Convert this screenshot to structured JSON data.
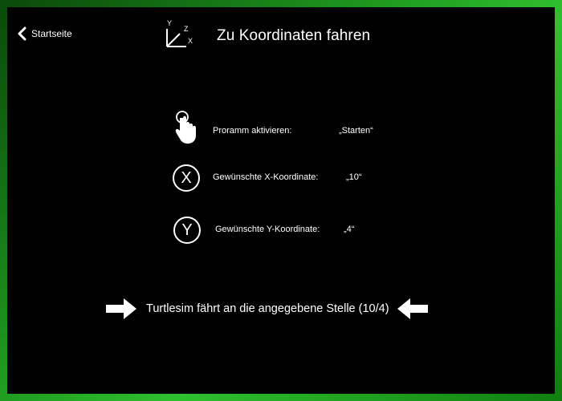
{
  "nav": {
    "back_label": "Startseite"
  },
  "header": {
    "icon_axis_labels": [
      "Y",
      "Z",
      "X"
    ],
    "title": "Zu Koordinaten fahren"
  },
  "steps": [
    {
      "icon": "touch-hand-icon",
      "label": "Proramm aktivieren:",
      "value": "„Starten“"
    },
    {
      "icon": "x-circle-icon",
      "icon_text": "X",
      "label": "Gewünschte X-Koordinate:",
      "value": "„10“"
    },
    {
      "icon": "y-circle-icon",
      "icon_text": "Y",
      "label": "Gewünschte Y-Koordinate:",
      "value": "„4“"
    }
  ],
  "result": {
    "text": "Turtlesim fährt an die angegebene Stelle (10/4)",
    "left_icon": "arrow-right-icon",
    "right_icon": "arrow-left-icon"
  },
  "colors": {
    "background": "#000000",
    "border": "#1f9a1f",
    "text": "#ffffff"
  }
}
